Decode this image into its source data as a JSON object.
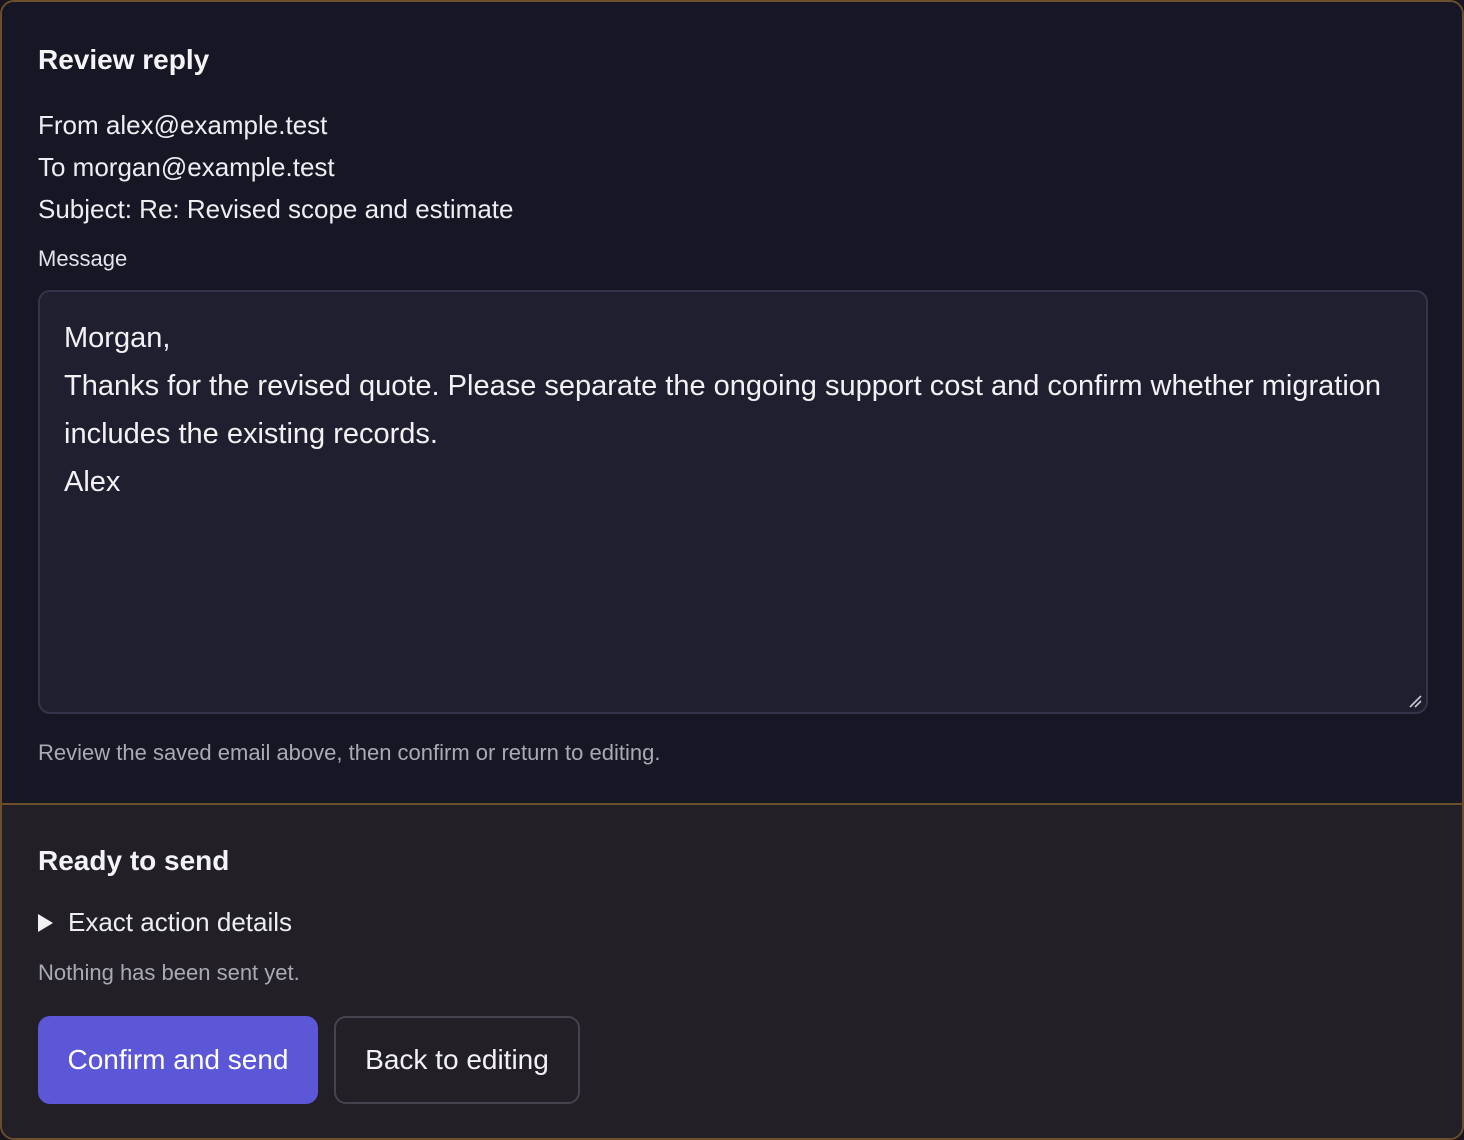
{
  "review": {
    "title": "Review reply",
    "from": "From alex@example.test",
    "to": "To morgan@example.test",
    "subject": "Subject: Re: Revised scope and estimate",
    "message_label": "Message",
    "message_lines": [
      "Morgan,",
      "Thanks for the revised quote. Please separate the ongoing support cost and confirm whether migration includes the existing records.",
      "Alex"
    ],
    "hint": "Review the saved email above, then confirm or return to editing."
  },
  "send": {
    "title": "Ready to send",
    "details_label": "Exact action details",
    "status": "Nothing has been sent yet.",
    "confirm_label": "Confirm and send",
    "back_label": "Back to editing"
  },
  "colors": {
    "accent": "#5b57d6",
    "border_accent": "#6b4e2a"
  },
  "icons": {
    "details_toggle": "triangle-right-icon",
    "resize": "resize-handle-icon"
  }
}
